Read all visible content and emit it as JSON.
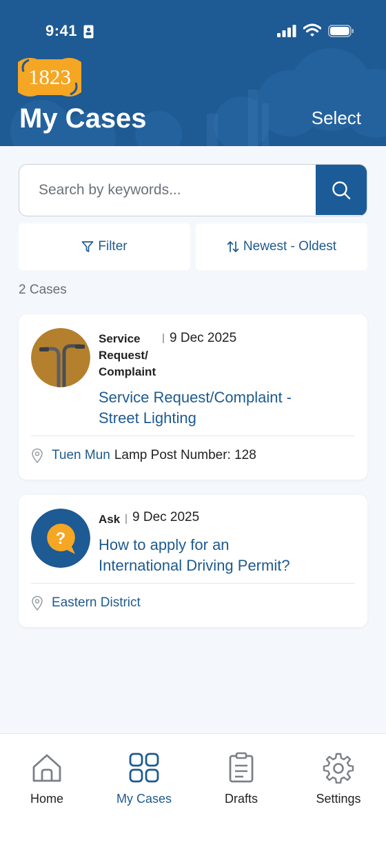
{
  "status_bar": {
    "time": "9:41"
  },
  "header": {
    "logo": "1823",
    "title": "My Cases",
    "select_label": "Select"
  },
  "search": {
    "placeholder": "Search by keywords..."
  },
  "controls": {
    "filter_label": "Filter",
    "sort_label": "Newest - Oldest"
  },
  "case_count": "2 Cases",
  "cases": [
    {
      "category": "Service Request/ Complaint",
      "category_lines": [
        "Service",
        "Request/",
        "Complaint"
      ],
      "date": "9 Dec 2025",
      "title_lines": [
        "Service Request/Complaint -",
        "Street Lighting"
      ],
      "district": "Tuen Mun",
      "location_detail": "Lamp Post Number: 128",
      "icon": "street-lamp-icon"
    },
    {
      "category": "Ask",
      "date": "9 Dec 2025",
      "title_lines": [
        "How to apply for an",
        "International Driving Permit?"
      ],
      "district": "Eastern District",
      "location_detail": "",
      "icon": "question-bubble-icon"
    }
  ],
  "nav": [
    {
      "label": "Home",
      "icon": "home-icon",
      "active": false
    },
    {
      "label": "My Cases",
      "icon": "grid-icon",
      "active": true
    },
    {
      "label": "Drafts",
      "icon": "clipboard-icon",
      "active": false
    },
    {
      "label": "Settings",
      "icon": "gear-icon",
      "active": false
    }
  ],
  "colors": {
    "primary": "#1e5a93",
    "accent": "#1d5a8f",
    "logo_orange": "#f5a623",
    "background": "#f4f7fb"
  }
}
